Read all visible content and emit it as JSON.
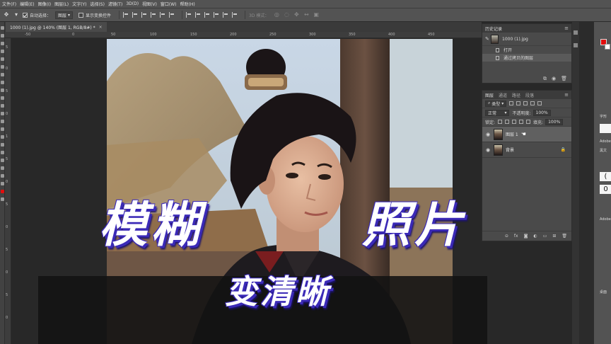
{
  "menu": [
    "文件(F)",
    "编辑(E)",
    "图像(I)",
    "图层(L)",
    "文字(Y)",
    "选择(S)",
    "滤镜(T)",
    "3D(D)",
    "视图(V)",
    "窗口(W)",
    "帮助(H)"
  ],
  "options_bar": {
    "auto_select_label": "自动选择：",
    "auto_select_value": "图层",
    "show_transform_label": "显示变换控件",
    "mode_3d_label": "3D 模式："
  },
  "document_tab": {
    "title": "1000 (1).jpg @ 140% (图层 1, RGB/8#) *",
    "close": "×"
  },
  "ruler": {
    "h": [
      "-50",
      "0",
      "50",
      "100",
      "150",
      "200",
      "250",
      "300",
      "350",
      "400",
      "450"
    ],
    "v": [
      "5",
      "0",
      "5",
      "0",
      "1",
      "5",
      "0",
      "5",
      "0",
      "5",
      "0",
      "5",
      "0"
    ]
  },
  "overlay": {
    "headline_left": "模糊",
    "headline_right": "照片",
    "subline": "变清晰"
  },
  "history_panel": {
    "tabs": [
      "历史记录"
    ],
    "snapshot_name": "1000 (1).jpg",
    "items": [
      "打开",
      "通过拷贝的图层"
    ]
  },
  "layers_panel": {
    "tabs": [
      "图层",
      "通道",
      "路径",
      "段落"
    ],
    "filter_kind": "类型",
    "blend_mode": "正常",
    "opacity_label": "不透明度:",
    "opacity_value": "100%",
    "lock_label": "锁定:",
    "fill_label": "填充:",
    "fill_value": "100%",
    "layers": [
      {
        "name": "图层 1",
        "selected": true
      },
      {
        "name": "背景",
        "selected": false,
        "locked": true
      }
    ]
  },
  "right_tools": {
    "label_character": "字形",
    "label_adobe1": "Adobe",
    "label_style": "黑文",
    "label_adobe2": "Adobe",
    "label_bottom": "桌面"
  },
  "colors": {
    "foreground": "#e20d0d",
    "background": "#ffffff",
    "headline_outline": "#3b2ab7"
  }
}
